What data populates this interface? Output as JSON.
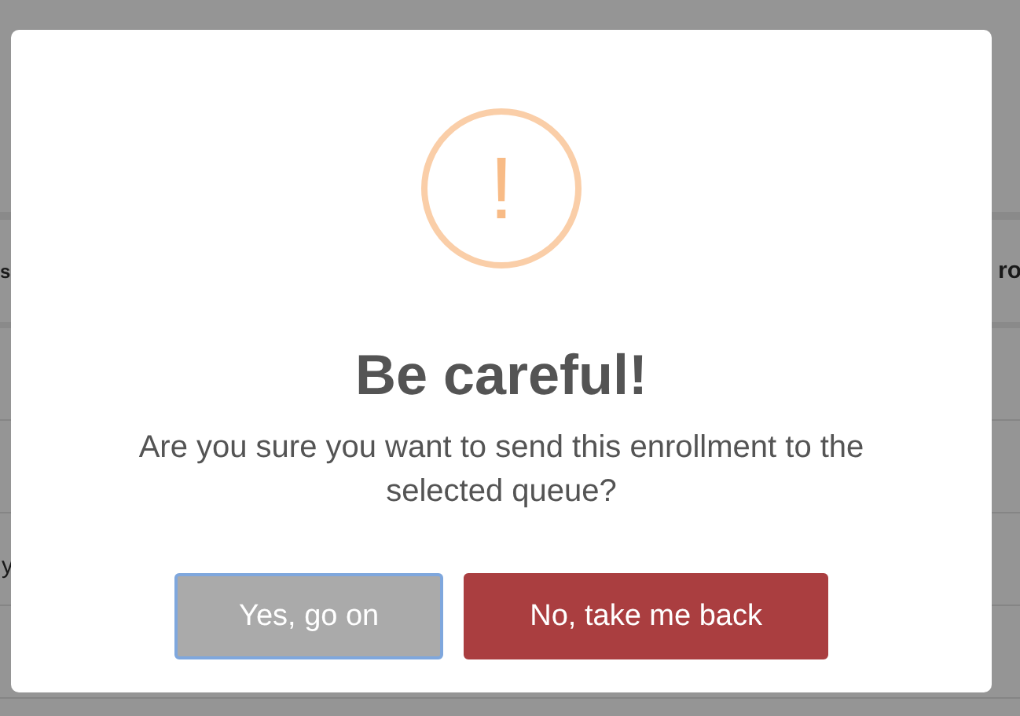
{
  "background_table": {
    "columns": [
      "s",
      "ro"
    ],
    "rows": [
      [
        "",
        ""
      ],
      [
        "",
        ""
      ],
      [
        "y",
        ""
      ],
      [
        "",
        ""
      ]
    ]
  },
  "dialog": {
    "icon": "!",
    "title": "Be careful!",
    "message": "Are you sure you want to send this enrollment to the selected queue?",
    "buttons": [
      {
        "label": "Yes, go on",
        "kind": "secondary",
        "focused": true
      },
      {
        "label": "No, take me back",
        "kind": "danger",
        "focused": false
      }
    ]
  }
}
